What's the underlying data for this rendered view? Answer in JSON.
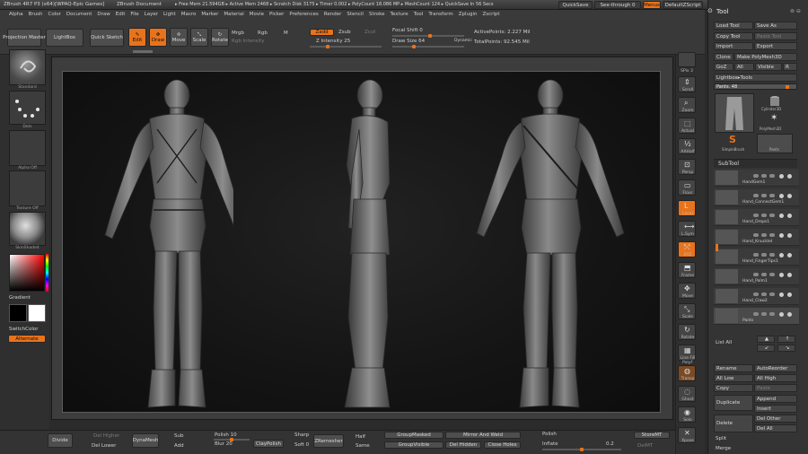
{
  "titlebar": {
    "app": "ZBrush 4R7 P3 (x64)[WPAQ-Epic Games]",
    "doc": "ZBrush Document",
    "mem": "▸ Free Mem 21.594GB ▸ Active Mem 2468 ▸ Scratch Disk 3175 ▸ Timer 0.002 ▸ PolyCount 18.086 MP ▸ MeshCount 124 ▸ QuickSave In 56 Secs",
    "quicksave": "QuickSave",
    "seethrough": "See-through",
    "seethrough_value": "0",
    "menus": "Menus",
    "script": "DefaultZScript"
  },
  "menubar": [
    "Alpha",
    "Brush",
    "Color",
    "Document",
    "Draw",
    "Edit",
    "File",
    "Layer",
    "Light",
    "Macro",
    "Marker",
    "Material",
    "Movie",
    "Picker",
    "Preferences",
    "Render",
    "Stencil",
    "Stroke",
    "Texture",
    "Tool",
    "Transform",
    "Zplugin",
    "Zscript"
  ],
  "topshelf": {
    "projection_master": "Projection Master",
    "lightbox": "LightBox",
    "quick_sketch": "Quick Sketch",
    "edit": "Edit",
    "draw": "Draw",
    "move": "Move",
    "scale": "Scale",
    "rotate": "Rotate",
    "mrgb": "Mrgb",
    "rgb": "Rgb",
    "m": "M",
    "rgb_intensity": "Rgb Intensity",
    "zadd": "Zadd",
    "zsub": "Zsub",
    "zcut": "Zcut",
    "z_intensity": "Z Intensity 25",
    "focal_shift": "Focal Shift 0",
    "draw_size": "Draw Size 64",
    "dynamic": "Dynamic",
    "active_points": "ActivePoints: 2.227 Mil",
    "total_points": "TotalPoints: 92.545 Mil"
  },
  "leftshelf": {
    "brush_caption": "Standard",
    "stroke_caption": "Dots",
    "alpha_caption": "Alpha Off",
    "texture_caption": "Texture Off",
    "material_caption": "SkinShade4",
    "gradient": "Gradient",
    "switchcolor": "SwitchColor",
    "alternate": "Alternate"
  },
  "rightshelf": [
    "SPix 3",
    "Scroll",
    "Zoom",
    "Actual",
    "AAHalf",
    "Persp",
    "Floor",
    "Local",
    "L.Sym",
    "XYZ",
    "Frame",
    "Move",
    "Scale",
    "Rotate",
    "Line Fill PolyF",
    "Transp",
    "Ghost",
    "Solo",
    "Xpose"
  ],
  "toolpanel": {
    "title": "Tool",
    "load_tool": "Load Tool",
    "save_as": "Save As",
    "copy_tool": "Copy Tool",
    "paste_tool": "Paste Tool",
    "import": "Import",
    "export": "Export",
    "clone": "Clone",
    "make_polymesh": "Make PolyMesh3D",
    "goz": "GoZ",
    "all": "All",
    "visible": "Visible",
    "r": "R",
    "lightbox_tools": "Lightbox▸Tools",
    "pants": "Pants. 48",
    "subtool_header": "SubTool",
    "tool_thumbs": [
      "Cylinder3D",
      "PolyMesh3D",
      "SimpleBrush",
      "Pants"
    ],
    "subtools": [
      "HandGem1",
      "Hand_ConnectGem1",
      "Hand_Drops1",
      "Hand_KnuckleI",
      "Hand_FingerTips1",
      "Hand_Palm1",
      "Hand_Claw2",
      "Pants"
    ],
    "list_all": "List All",
    "rename": "Rename",
    "autoreorder": "AutoReorder",
    "all_low": "All Low",
    "all_high": "All High",
    "copy": "Copy",
    "paste": "Paste",
    "duplicate": "Duplicate",
    "append": "Append",
    "insert": "Insert",
    "delete": "Delete",
    "del_other": "Del Other",
    "del_all": "Del All",
    "split": "Split",
    "merge": "Merge"
  },
  "bottomshelf": {
    "divide": "Divide",
    "del_higher": "Del Higher",
    "del_lower": "Del Lower",
    "dynamesh": "DynaMesh",
    "sub": "Sub",
    "add": "Add",
    "polish": "Polish 10",
    "blur": "Blur 20",
    "clay_polish": "ClayPolish",
    "sharp": "Sharp",
    "soft": "Soft 0",
    "zremesher": "ZRemesher",
    "half": "Half",
    "same": "Same",
    "group_masked": "GroupMasked",
    "group_visible": "GroupVisible",
    "mirror_weld": "Mirror And Weld",
    "del_hidden": "Del Hidden",
    "close_holes": "Close Holes",
    "polish2": "Polish",
    "inflate": "Inflate",
    "inflate_value": "0.2",
    "storemt": "StoreMT",
    "delmt": "DelMT"
  }
}
